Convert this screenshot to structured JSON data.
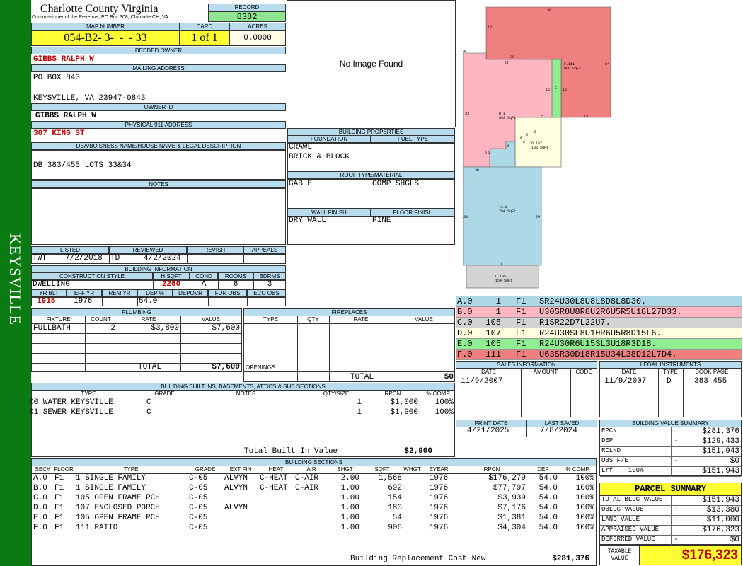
{
  "town": "KEYSVILLE",
  "header": {
    "county": "Charlotte County Virginia",
    "commissioner": "Commissioner of the Revenue, PO Box 308, Charlotte CH, VA",
    "record_label": "RECORD",
    "record": "8382",
    "map_label": "MAP NUMBER",
    "map": "054-B2- 3-  -  - 33",
    "card_label": "CARD",
    "card": "1 of 1",
    "acres_label": "ACRES",
    "acres": "0.0000"
  },
  "owner": {
    "deeded_label": "DEEDED OWNER",
    "deeded": "GIBBS RALPH W",
    "mailing_label": "MAILING ADDRESS",
    "mail1": "PO BOX 843",
    "mail2": "KEYSVILLE, VA 23947-0843",
    "ownerid_label": "OWNER ID",
    "ownerid": "GIBBS RALPH W",
    "phys_label": "PHYSICAL 911 ADDRESS",
    "phys": "307 KING ST",
    "dba_label": "DBA/BUISNESS NAME/HOUSE NAME & LEGAL DESCRIPTION",
    "dba": "DB 383/455 LOTS 33&34",
    "notes_label": "NOTES"
  },
  "photo": {
    "text": "No Image Found"
  },
  "bprops": {
    "title": "BUILDING PROPERTIES",
    "foundation_label": "FOUNDATION",
    "fuel_label": "FUEL TYPE",
    "foundation1": "CRAWL",
    "foundation2": "BRICK & BLOCK",
    "roof_label": "ROOF TYPE/MATERIAL",
    "roof1": "GABLE",
    "roof2": "COMP SHGLS",
    "wall_label": "WALL FINISH",
    "floor_label": "FLOOR FINISH",
    "wall": "DRY WALL",
    "floor": "PINE"
  },
  "review": {
    "listed_label": "LISTED",
    "reviewed_label": "REVIEWED",
    "revisit_label": "REVISIT",
    "appeals_label": "APPEALS",
    "listed_by": "TWT",
    "listed": "7/2/2018",
    "reviewed_by": "TD",
    "reviewed": "4/2/2024"
  },
  "binfo": {
    "title": "BUILDING INFORMATION",
    "style_label": "CONSTRUCTION STYLE",
    "hsqft_label": "H SQFT",
    "cond_label": "COND",
    "rooms_label": "ROOMS",
    "bdrms_label": "BDRMS",
    "style": "DWELLING",
    "hsqft": "2260",
    "cond": "A",
    "rooms": "6",
    "bdrms": "3",
    "yrblt_label": "YR BLT",
    "effyr_label": "EFF YR",
    "remyr_label": "REM YR",
    "dep_label": "DEP %",
    "depovr_label": "DEPOVR",
    "funobs_label": "FUN OBS",
    "ecoobs_label": "ECO OBS",
    "yrblt": "1915",
    "effyr": "1976",
    "dep": "54.0"
  },
  "plumbing": {
    "title": "PLUMBING",
    "h": [
      "FIXTURE",
      "COUNT",
      "RATE",
      "VALUE"
    ],
    "rows": [
      [
        "FULLBATH",
        "2",
        "$3,800",
        "$7,600"
      ]
    ],
    "total_label": "TOTAL",
    "total": "$7,600"
  },
  "fireplaces": {
    "title": "FIREPLACES",
    "h": [
      "TYPE",
      "QTY",
      "RATE",
      "VALUE"
    ],
    "openings": "OPENINGS",
    "total_label": "TOTAL",
    "total": "$0"
  },
  "builtins": {
    "title": "BUILDING BUILT INS, BASEMENTS, ATTICS & SUB SECTIONS",
    "h": [
      "TYPE",
      "GRADE",
      "NOTES",
      "QTY/SIZE",
      "RPCN",
      "% COMP"
    ],
    "rows": [
      [
        "00 WATER KEYSVILLE",
        "C",
        "",
        "1",
        "$1,000",
        "100%"
      ],
      [
        "01 SEWER KEYSVILLE",
        "C",
        "",
        "1",
        "$1,900",
        "100%"
      ]
    ],
    "total_label": "Total Built In Value",
    "total": "$2,900"
  },
  "sections": {
    "title": "BUILDING SECTIONS",
    "h": [
      "SEC#",
      "FLOOR",
      "TYPE",
      "GRADE",
      "EXT FIN",
      "HEAT",
      "AIR",
      "SHGT",
      "SQFT",
      "WHGT",
      "EYEAR",
      "RPCN",
      "DEP",
      "% COMP"
    ],
    "rows": [
      [
        "A.0",
        "F1",
        "1 SINGLE FAMILY",
        "C-05",
        "ALVYN",
        "C-HEAT",
        "C-AIR",
        "2.00",
        "1,568",
        "",
        "1976",
        "$176,279",
        "54.0",
        "100%"
      ],
      [
        "B.0",
        "F1",
        "1 SINGLE FAMILY",
        "C-05",
        "ALVYN",
        "C-HEAT",
        "C-AIR",
        "1.00",
        "692",
        "",
        "1976",
        "$77,797",
        "54.0",
        "100%"
      ],
      [
        "C.0",
        "F1",
        "105 OPEN FRAME PCH",
        "C-05",
        "",
        "",
        "",
        "1.00",
        "154",
        "",
        "1976",
        "$3,939",
        "54.0",
        "100%"
      ],
      [
        "D.0",
        "F1",
        "107 ENCLOSED PORCH",
        "C-05",
        "ALVYN",
        "",
        "",
        "1.00",
        "180",
        "",
        "1976",
        "$7,176",
        "54.0",
        "100%"
      ],
      [
        "E.0",
        "F1",
        "105 OPEN FRAME PCH",
        "C-05",
        "",
        "",
        "",
        "1.00",
        "54",
        "",
        "1976",
        "$1,381",
        "54.0",
        "100%"
      ],
      [
        "F.0",
        "F1",
        "111 PATIO",
        "C-05",
        "",
        "",
        "",
        "1.00",
        "906",
        "",
        "1976",
        "$4,304",
        "54.0",
        "100%"
      ]
    ],
    "total_label": "Building Replacement Cost New",
    "total": "$281,376"
  },
  "sketch": {
    "labels": [
      {
        "t": "A.1",
        "s": "784 SqFt"
      },
      {
        "t": "B.1",
        "s": "692 SqFt"
      },
      {
        "t": "C.105",
        "s": "154 SqFt"
      },
      {
        "t": "D.107",
        "s": "180 SqFt"
      },
      {
        "t": "E",
        "s": ""
      },
      {
        "t": "F.111",
        "s": "906 SqFt"
      }
    ],
    "dims": [
      "38",
      "12",
      "4",
      "30",
      "27",
      "34",
      "33",
      "16",
      "16",
      "15",
      "5",
      "6",
      "8",
      "8",
      "6",
      "8",
      "8",
      "8",
      "30",
      "30",
      "24",
      "7"
    ]
  },
  "vectors": [
    {
      "sec": "A.0",
      "n": "1",
      "f": "F1",
      "v": "SR24U30L8U8L8D8L8D30.",
      "c": "#add8e6"
    },
    {
      "sec": "B.0",
      "n": "1",
      "f": "F1",
      "v": "U30SR8U8R8U2R6U5R5U18L27D33.",
      "c": "#ffb6c1"
    },
    {
      "sec": "C.0",
      "n": "105",
      "f": "F1",
      "v": "R1SR22D7L22U7.",
      "c": "#d3d3d3"
    },
    {
      "sec": "D.0",
      "n": "107",
      "f": "F1",
      "v": "R24U30SL8U10R6U5R8D15L6.",
      "c": "#ffffe0"
    },
    {
      "sec": "E.0",
      "n": "105",
      "f": "F1",
      "v": "R24U30R6U15SL3U18R3D18.",
      "c": "#90ee90"
    },
    {
      "sec": "F.0",
      "n": "111",
      "f": "F1",
      "v": "U63SR30D18R15U34L38D12L7D4.",
      "c": "#f08080"
    }
  ],
  "sales": {
    "title": "SALES INFORMATION",
    "h": [
      "DATE",
      "AMOUNT",
      "CODE"
    ],
    "date": "11/9/2007"
  },
  "legal": {
    "title": "LEGAL INSTRUMENTS",
    "h": [
      "DATE",
      "TYPE",
      "BOOK PAGE"
    ],
    "date": "11/9/2007",
    "type": "D",
    "book": "383 455"
  },
  "dates": {
    "print_label": "PRINT DATE",
    "saved_label": "LAST SAVED",
    "print": "4/21/2025",
    "saved": "7/8/2024"
  },
  "bvs": {
    "title": "BUILDING VALUE SUMMARY",
    "rows": [
      [
        "RPCN",
        "",
        "$281,376"
      ],
      [
        "DEP",
        "-",
        "$129,433"
      ],
      [
        "RCLND",
        "",
        "$151,943"
      ],
      [
        "OBS F/E",
        "-",
        "$0"
      ],
      [
        "Lrf    100%",
        "",
        "$151,943"
      ]
    ]
  },
  "parcel": {
    "title": "PARCEL SUMMARY",
    "rows": [
      [
        "TOTAL BLDG VALUE",
        "",
        "$151,943"
      ],
      [
        "OBLDG VALUE",
        "+",
        "$13,380"
      ],
      [
        "LAND VALUE",
        "+",
        "$11,000"
      ],
      [
        "APPRAISED VALUE",
        "",
        "$176,323"
      ],
      [
        "DEFERRED VALUE",
        "-",
        "$0"
      ]
    ],
    "taxable_label1": "TAXABLE",
    "taxable_label2": "VALUE",
    "taxable": "$176,323"
  }
}
